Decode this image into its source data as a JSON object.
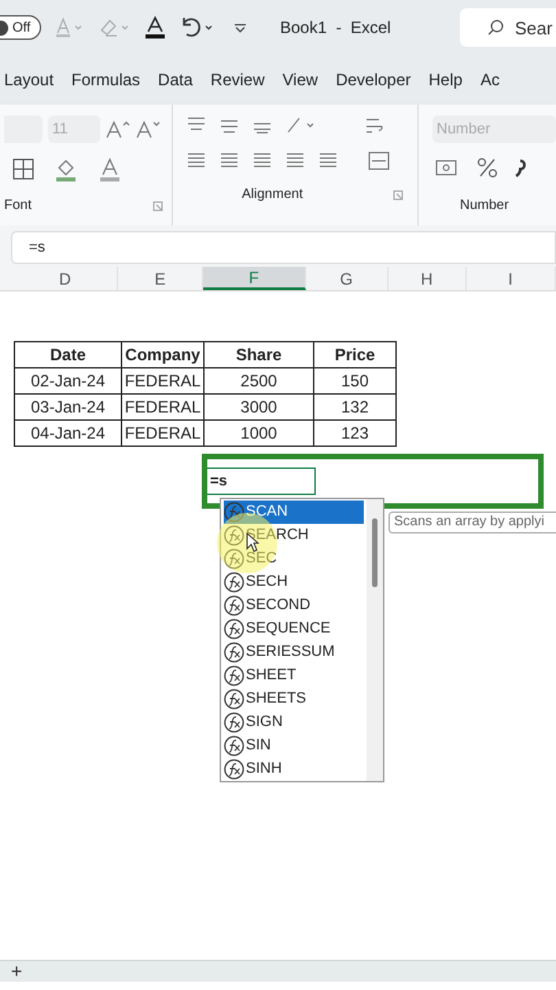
{
  "title_bar": {
    "autosave": {
      "label": "Off",
      "on": false
    },
    "title": "Book1  -  Excel",
    "search": {
      "placeholder": "Sear"
    }
  },
  "tabs": [
    {
      "label": "Layout",
      "selected": false
    },
    {
      "label": "Formulas",
      "selected": false
    },
    {
      "label": "Data",
      "selected": false
    },
    {
      "label": "Review",
      "selected": false
    },
    {
      "label": "View",
      "selected": false
    },
    {
      "label": "Developer",
      "selected": false
    },
    {
      "label": "Help",
      "selected": false
    },
    {
      "label": "Ac",
      "selected": false
    }
  ],
  "ribbon": {
    "font_size": "11",
    "number_format": {
      "placeholder": "Number"
    },
    "groups": [
      "Font",
      "Alignment",
      "Number"
    ]
  },
  "formula_bar": {
    "value": "=s"
  },
  "columns": [
    {
      "label": "D",
      "selected": false
    },
    {
      "label": "E",
      "selected": false
    },
    {
      "label": "F",
      "selected": true
    },
    {
      "label": "G",
      "selected": false
    },
    {
      "label": "H",
      "selected": false
    },
    {
      "label": "I",
      "selected": false
    }
  ],
  "table": {
    "columns": [
      "Date",
      "Company",
      "Share",
      "Price"
    ],
    "rows": [
      [
        "02-Jan-24",
        "FEDERAL",
        "2500",
        "150"
      ],
      [
        "03-Jan-24",
        "FEDERAL",
        "3000",
        "132"
      ],
      [
        "04-Jan-24",
        "FEDERAL",
        "1000",
        "123"
      ]
    ]
  },
  "cell_editor": {
    "value": "=s"
  },
  "autocomplete": {
    "items": [
      {
        "label": "SCAN",
        "selected": true
      },
      {
        "label": "SEARCH",
        "selected": false
      },
      {
        "label": "SEC",
        "selected": false
      },
      {
        "label": "SECH",
        "selected": false
      },
      {
        "label": "SECOND",
        "selected": false
      },
      {
        "label": "SEQUENCE",
        "selected": false
      },
      {
        "label": "SERIESSUM",
        "selected": false
      },
      {
        "label": "SHEET",
        "selected": false
      },
      {
        "label": "SHEETS",
        "selected": false
      },
      {
        "label": "SIGN",
        "selected": false
      },
      {
        "label": "SIN",
        "selected": false
      },
      {
        "label": "SINH",
        "selected": false
      }
    ],
    "tooltip": "Scans an array by applyi"
  },
  "sheet_bar": {
    "add_label": "+"
  }
}
